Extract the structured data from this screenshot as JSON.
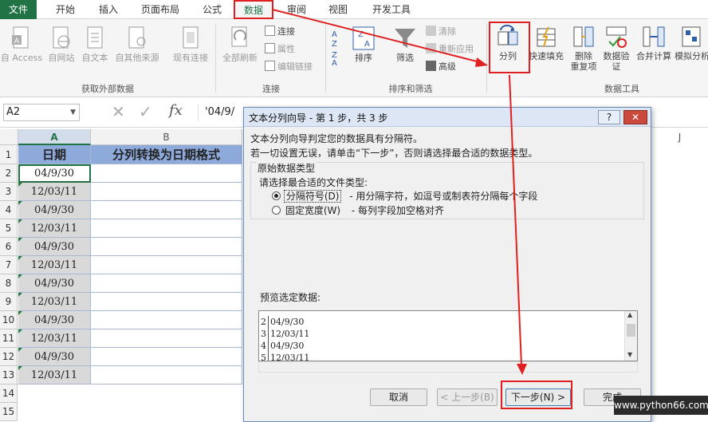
{
  "tabs": [
    "文件",
    "开始",
    "插入",
    "页面布局",
    "公式",
    "数据",
    "审阅",
    "视图",
    "开发工具"
  ],
  "active_tab": "数据",
  "ribbon": {
    "get_external": {
      "label": "获取外部数据",
      "items": [
        "自 Access",
        "自网站",
        "自文本",
        "自其他来源",
        "现有连接"
      ]
    },
    "connections": {
      "label": "连接",
      "refresh_all": "全部刷新",
      "small": [
        "连接",
        "属性",
        "编辑链接"
      ]
    },
    "sort_filter": {
      "label": "排序和筛选",
      "sort": "排序",
      "filter": "筛选",
      "small": [
        "清除",
        "重新应用",
        "高级"
      ]
    },
    "data_tools": {
      "label": "数据工具",
      "text_to_columns": "分列",
      "flash_fill": "快速填充",
      "remove_dup_1": "删除",
      "remove_dup_2": "重复项",
      "validation_1": "数据验",
      "validation_2": "证",
      "consolidate": "合并计算",
      "what_if": "模拟分析"
    }
  },
  "formula_bar": {
    "name_box": "A2",
    "fx": "fx",
    "content": "'04/9/"
  },
  "sheet": {
    "columns": [
      "A",
      "B",
      "J"
    ],
    "header_A": "日期",
    "header_B": "分列转换为日期格式",
    "row_numbers": [
      "1",
      "2",
      "3",
      "4",
      "5",
      "6",
      "7",
      "8",
      "9",
      "10",
      "11",
      "12",
      "13",
      "14",
      "15"
    ],
    "values": [
      "04/9/30",
      "12/03/11",
      "04/9/30",
      "12/03/11",
      "04/9/30",
      "12/03/11",
      "04/9/30",
      "12/03/11",
      "04/9/30",
      "12/03/11",
      "04/9/30",
      "12/03/11"
    ]
  },
  "dialog": {
    "title": "文本分列向导 - 第 1 步，共 3 步",
    "help": "?",
    "close": "✕",
    "line1": "文本分列向导判定您的数据具有分隔符。",
    "line2": "若一切设置无误，请单击“下一步”，否则请选择最合适的数据类型。",
    "section": "原始数据类型",
    "choose": "请选择最合适的文件类型:",
    "opt1_label": "分隔符号(D)",
    "opt1_desc": "- 用分隔字符，如逗号或制表符分隔每个字段",
    "opt2_label": "固定宽度(W)",
    "opt2_desc": "- 每列字段加空格对齐",
    "preview_label": "预览选定数据:",
    "preview_rows": [
      {
        "n": "2",
        "v": "04/9/30"
      },
      {
        "n": "3",
        "v": "12/03/11"
      },
      {
        "n": "4",
        "v": "04/9/30"
      },
      {
        "n": "5",
        "v": "12/03/11"
      }
    ],
    "cancel": "取消",
    "back": "< 上一步(B)",
    "next": "下一步(N) >",
    "finish": "完成"
  },
  "watermark": "www.python66.com",
  "colors": {
    "excel_green": "#217346",
    "highlight_red": "#e02020",
    "header_fill": "#8eaadb"
  }
}
